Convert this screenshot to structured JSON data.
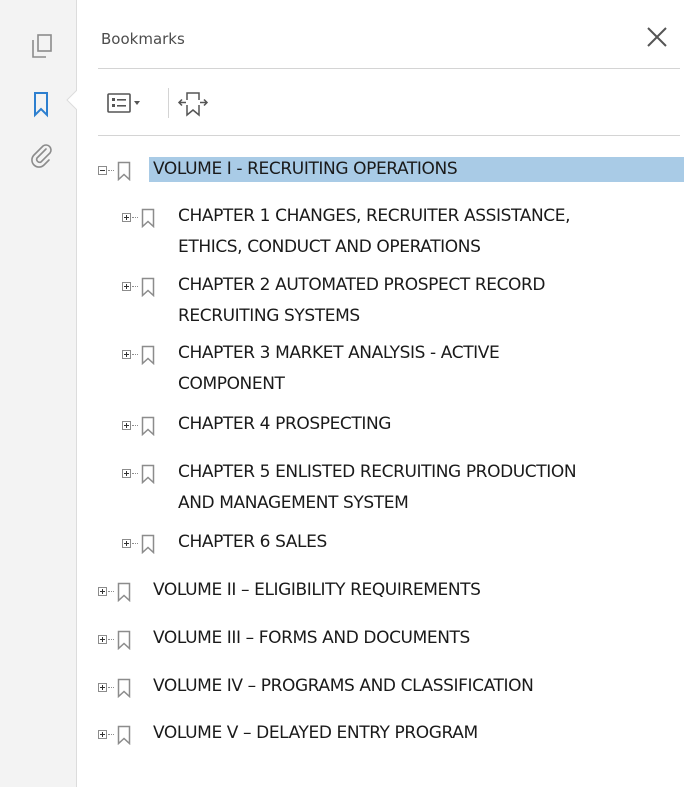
{
  "panel": {
    "title": "Bookmarks"
  },
  "rail": {
    "icons": [
      "page-thumbnails-icon",
      "bookmark-icon",
      "attachment-paperclip-icon"
    ],
    "active": "bookmark-icon"
  },
  "toolbar": {
    "icons": [
      "options-menu-icon",
      "expand-current-bookmark-icon"
    ]
  },
  "colors": {
    "accent": "#2d7fcf",
    "selection": "#a9cbe6",
    "icon_gray": "#8c8c8c"
  },
  "tree": {
    "volume1": {
      "label": "VOLUME I - RECRUITING OPERATIONS",
      "expanded": true,
      "selected": true,
      "chapters": [
        {
          "line1": "CHAPTER 1 CHANGES, RECRUITER ASSISTANCE,",
          "line2": "ETHICS, CONDUCT AND OPERATIONS"
        },
        {
          "line1": "CHAPTER 2 AUTOMATED PROSPECT RECORD",
          "line2": "RECRUITING SYSTEMS"
        },
        {
          "line1": "CHAPTER 3 MARKET ANALYSIS - ACTIVE",
          "line2": "COMPONENT"
        },
        {
          "line1": "CHAPTER 4 PROSPECTING"
        },
        {
          "line1": "CHAPTER 5 ENLISTED RECRUITING PRODUCTION",
          "line2": "AND MANAGEMENT SYSTEM"
        },
        {
          "line1": "CHAPTER 6 SALES"
        }
      ]
    },
    "volumes": [
      {
        "label": "VOLUME II – ELIGIBILITY REQUIREMENTS"
      },
      {
        "label": "VOLUME III – FORMS AND DOCUMENTS"
      },
      {
        "label": "VOLUME IV – PROGRAMS AND CLASSIFICATION"
      },
      {
        "label": "VOLUME V – DELAYED ENTRY PROGRAM"
      }
    ]
  }
}
